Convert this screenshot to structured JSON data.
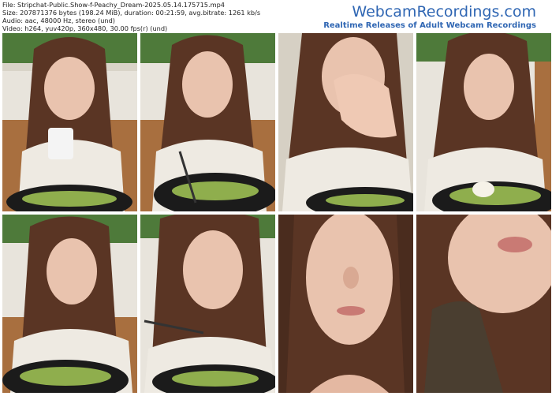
{
  "info": {
    "file_line": "File: Stripchat-Public.Show-f-Peachy_Dream-2025.05.14.175715.mp4",
    "size_line": "Size: 207871376 bytes (198.24 MiB), duration: 00:21:59, avg.bitrate: 1261 kb/s",
    "audio_line": "Audio: aac, 48000 Hz, stereo (und)",
    "video_line": "Video: h264, yuv420p, 360x480, 30.00 fps(r) (und)"
  },
  "brand": {
    "name": "WebcamRecordings.com",
    "tagline": "Realtime Releases of Adult Webcam Recordings"
  },
  "thumbnails": [
    {
      "desc": "eating-with-cup"
    },
    {
      "desc": "eating-with-fork-eyes-closed"
    },
    {
      "desc": "hand-over-mouth"
    },
    {
      "desc": "smiling-over-bowl"
    },
    {
      "desc": "looking-aside-bowl"
    },
    {
      "desc": "eyes-closed-fork"
    },
    {
      "desc": "closeup-face"
    },
    {
      "desc": "closeup-mouth"
    }
  ],
  "colors": {
    "brand": "#2f66b3",
    "hair": "#5a3524",
    "skin": "#e9c3ae",
    "sweater": "#eeeae2",
    "bowl": "#1b1b1b",
    "wall": "#e8e4dc",
    "plants": "#4e7a3a"
  }
}
